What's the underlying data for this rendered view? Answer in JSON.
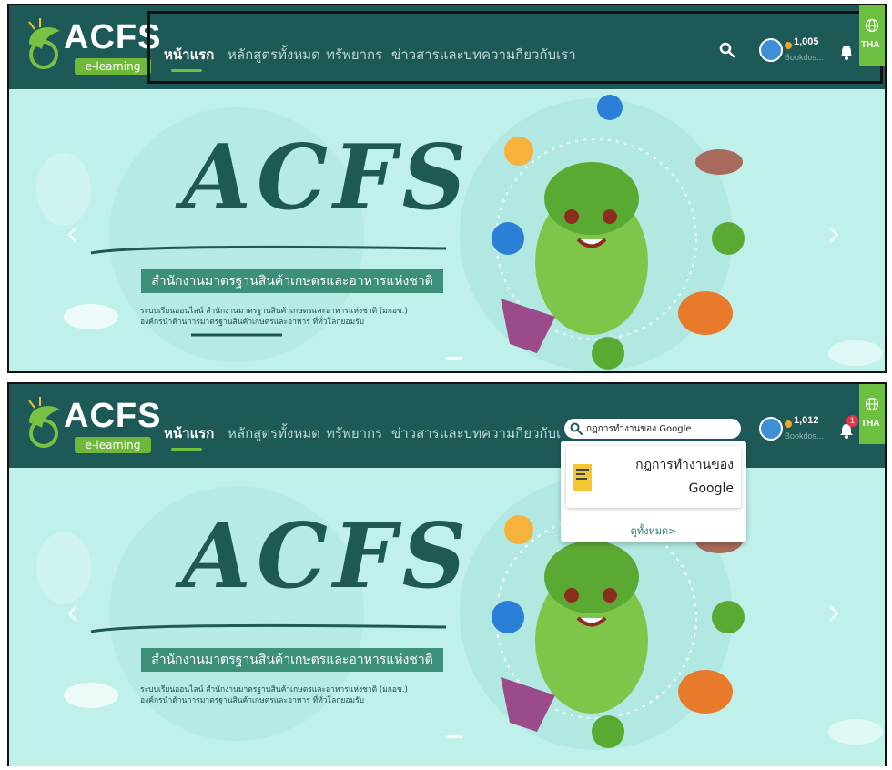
{
  "logo": {
    "title": "ACFS",
    "subtitle": "e-learning"
  },
  "nav": {
    "items": [
      "หน้าแรก",
      "หลักสูตรทั้งหมด",
      "ทรัพยากร",
      "ข่าวสารและบทความ",
      "เกี่ยวกับเรา"
    ],
    "active_index": 0
  },
  "screen1": {
    "user": {
      "points": "1,005",
      "name": "Bookdos..."
    },
    "language": "THA"
  },
  "screen2": {
    "user": {
      "points": "1,012",
      "name": "Bookdos..."
    },
    "notification_count": "1",
    "language": "THA",
    "search": {
      "value": "กฎการทำงานของ Google",
      "results": [
        {
          "title": "กฎการทำงานของ Google"
        }
      ],
      "view_all_label": "ดูทั้งหมด>"
    }
  },
  "hero": {
    "title": "ACFS",
    "ribbon": "สำนักงานมาตรฐานสินค้าเกษตรและอาหารแห่งชาติ",
    "description_line1": "ระบบเรียนออนไลน์ สำนักงานมาตรฐานสินค้าเกษตรและอาหารแห่งชาติ (มกอช.)",
    "description_line2": "องค์กรนำด้านการมาตรฐานสินค้าเกษตรและอาหาร ที่ทั่วโลกยอมรับ"
  },
  "icons": [
    "search-icon",
    "bell-icon",
    "globe-icon",
    "chevron-left-icon",
    "chevron-right-icon"
  ],
  "colors": {
    "navbar": "#1d5957",
    "accent": "#6fbf3c",
    "hero_bg": "#bff0ea",
    "badge": "#e8334a",
    "coin": "#f2a52b"
  }
}
